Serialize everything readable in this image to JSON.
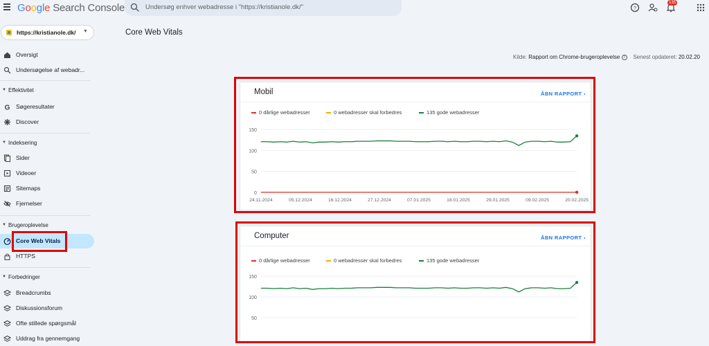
{
  "app": {
    "logo_g": "G",
    "logo_o1": "o",
    "logo_o2": "o",
    "logo_g2": "g",
    "logo_l": "l",
    "logo_e": "e",
    "logo_rest": " Search Console",
    "search_placeholder": "Undersøg enhver webadresse i \"https://kristianole.dk/\"",
    "notification_count": "135"
  },
  "sidebar": {
    "property": "https://kristianole.dk/",
    "items": {
      "oversigt": "Oversigt",
      "undersogelse": "Undersøgelse af webadr..."
    },
    "sections": {
      "effektivitet": "Effektivitet",
      "indeksering": "Indeksering",
      "brugeroplevelse": "Brugeroplevelse",
      "forbedringer": "Forbedringer"
    },
    "effektivitet_items": [
      "Søgeresultater",
      "Discover"
    ],
    "indeksering_items": [
      "Sider",
      "Videoer",
      "Sitemaps",
      "Fjernelser"
    ],
    "brugeroplevelse_items": [
      "Core Web Vitals",
      "HTTPS"
    ],
    "forbedringer_items": [
      "Breadcrumbs",
      "Diskussionsforum",
      "Ofte stillede spørgsmål",
      "Uddrag fra gennemgang"
    ]
  },
  "main": {
    "title": "Core Web Vitals",
    "source_label": "Kilde:",
    "source_value": "Rapport om Chrome-brugeroplevelse",
    "updated_label": "Senest opdateret:",
    "updated_value": "20.02.20",
    "open_report": "ÅBN RAPPORT"
  },
  "colors": {
    "poor": "#d93025",
    "needs_improvement": "#f9ab00",
    "good": "#188038",
    "accent": "#1a73e8",
    "highlight": "#e00000"
  },
  "chart_data": [
    {
      "type": "line",
      "title": "Mobil",
      "legend": [
        "0 dårlige webadresser",
        "0 webadresser skal forbedres",
        "135 gode webadresser"
      ],
      "yticks": [
        "150",
        "100",
        "50",
        "0"
      ],
      "ylim": [
        0,
        150
      ],
      "x": [
        "24.11.2024",
        "05.12.2024",
        "16.12.2024",
        "27.12.2024",
        "07.01.2025",
        "18.01.2025",
        "29.01.2025",
        "09.02.2025",
        "20.02.2025"
      ],
      "series": [
        {
          "name": "0 dårlige webadresser",
          "color": "#d93025",
          "values": [
            0,
            0,
            0,
            0,
            0,
            0,
            0,
            0,
            0,
            0,
            0,
            0,
            0,
            0,
            0,
            0,
            0,
            0,
            0,
            0,
            0,
            0,
            0,
            0,
            0,
            0,
            0,
            0,
            0,
            0,
            0,
            0,
            0,
            0,
            0,
            0,
            0,
            0,
            0,
            0,
            0,
            0,
            0,
            0,
            0,
            0,
            0,
            0,
            0,
            0
          ]
        },
        {
          "name": "135 gode webadresser",
          "color": "#188038",
          "values": [
            121,
            121,
            120,
            121,
            120,
            122,
            120,
            121,
            118,
            120,
            120,
            121,
            120,
            121,
            121,
            122,
            122,
            122,
            123,
            123,
            123,
            122,
            122,
            122,
            121,
            121,
            121,
            122,
            122,
            121,
            122,
            121,
            121,
            122,
            122,
            121,
            122,
            121,
            123,
            120,
            112,
            120,
            122,
            122,
            121,
            122,
            120,
            120,
            121,
            135
          ]
        }
      ]
    },
    {
      "type": "line",
      "title": "Computer",
      "legend": [
        "0 dårlige webadresser",
        "0 webadresser skal forbedres",
        "135 gode webadresser"
      ],
      "yticks": [
        "150",
        "100",
        "50"
      ],
      "ylim": [
        0,
        150
      ],
      "series": [
        {
          "name": "135 gode webadresser",
          "color": "#188038",
          "values": [
            121,
            121,
            120,
            121,
            120,
            122,
            120,
            121,
            118,
            120,
            120,
            121,
            120,
            121,
            121,
            122,
            122,
            122,
            123,
            123,
            123,
            122,
            122,
            122,
            121,
            121,
            121,
            122,
            122,
            121,
            122,
            121,
            121,
            122,
            122,
            121,
            122,
            121,
            123,
            120,
            112,
            120,
            122,
            122,
            121,
            122,
            120,
            120,
            121,
            135
          ]
        }
      ]
    }
  ]
}
